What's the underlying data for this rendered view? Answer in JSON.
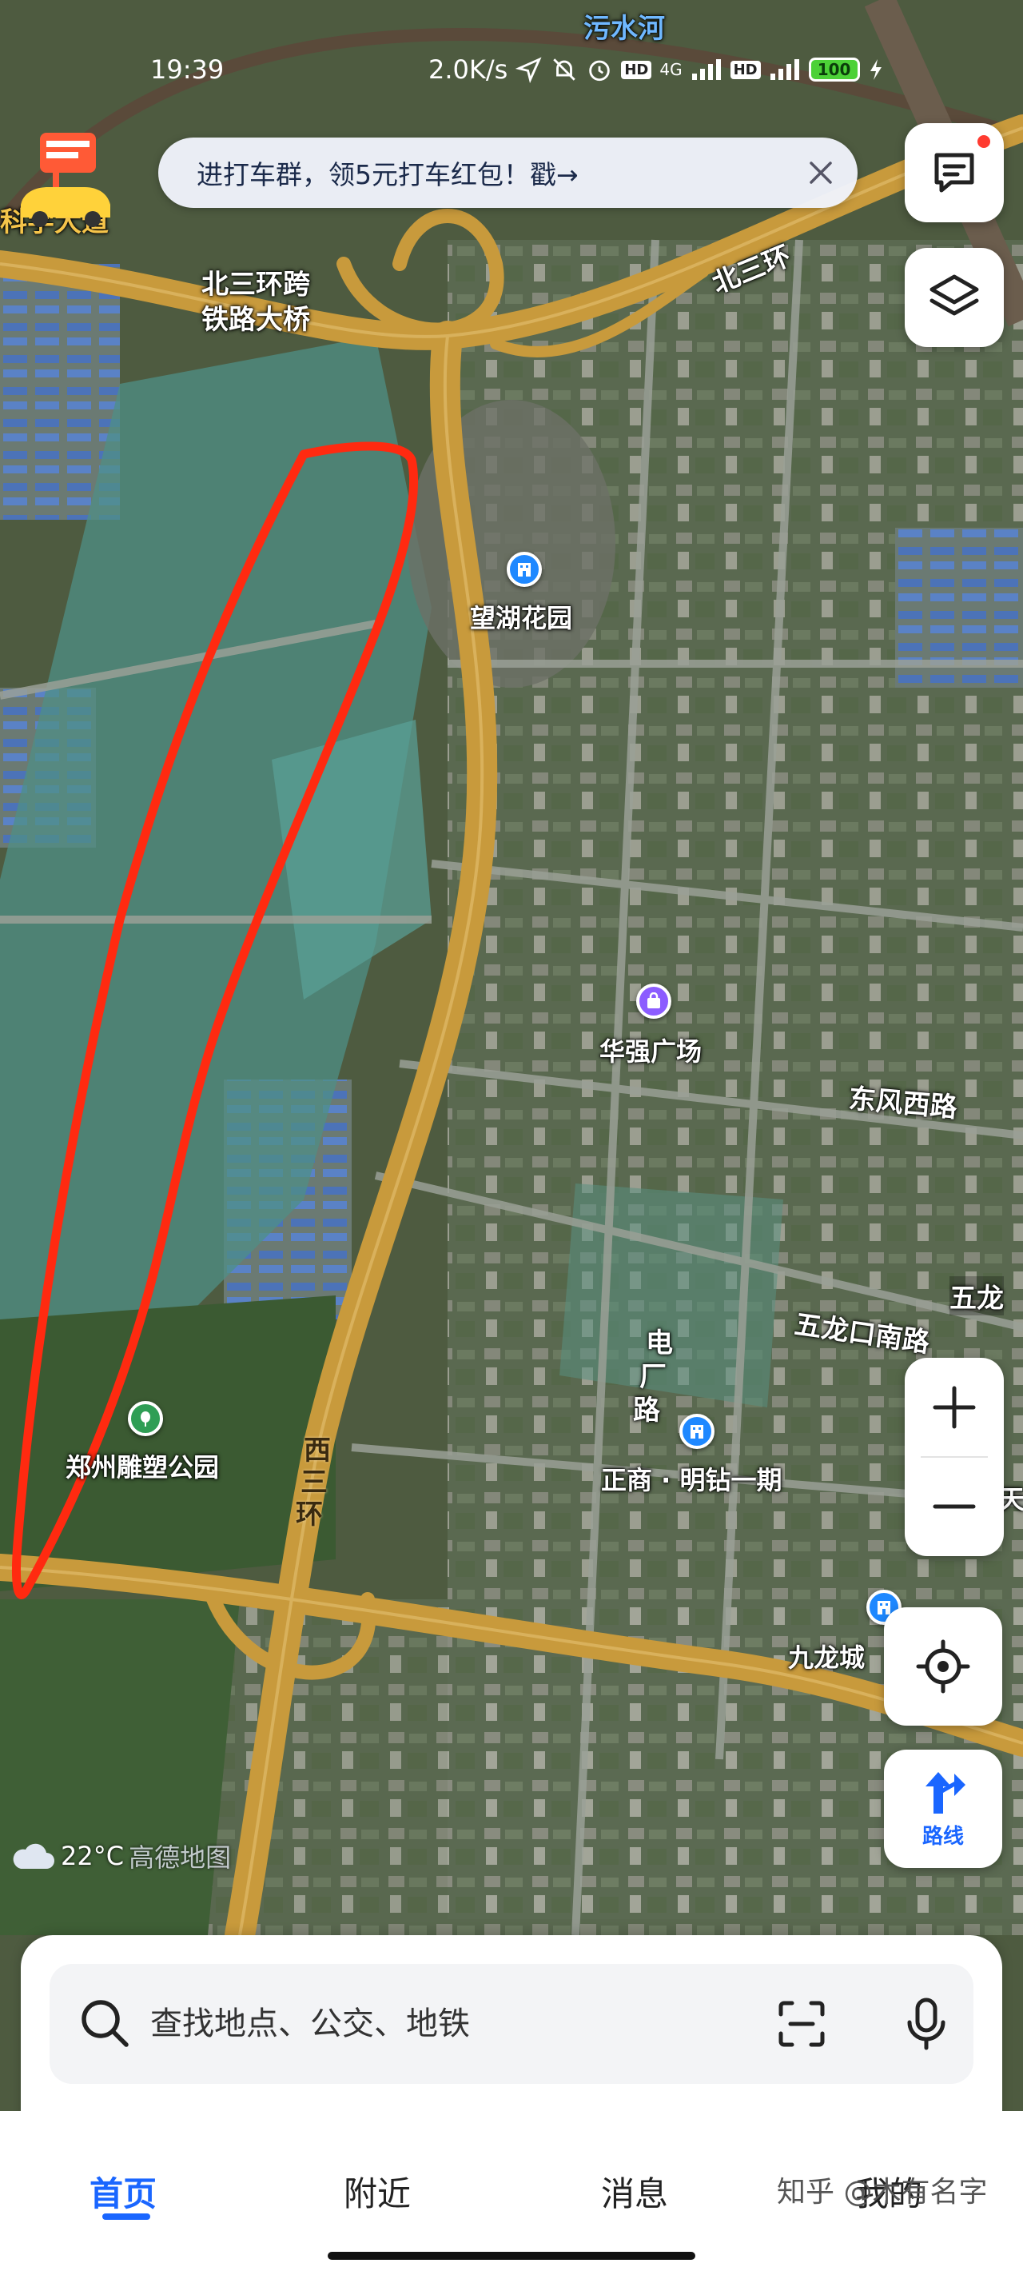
{
  "status_bar": {
    "time": "19:39",
    "network_speed": "2.0K/s",
    "network_type": "4G",
    "battery": "100"
  },
  "banner": {
    "text": "进打车群，领5元打车红包！戳→"
  },
  "map": {
    "labels": {
      "wushui_river": "污水河",
      "north_third_ring": "北三环",
      "north_bridge": [
        "北三环跨",
        "铁路大桥"
      ],
      "wanghu_garden": "望湖花园",
      "huaqiang_plaza": "华强广场",
      "dongfeng_west_road": "东风西路",
      "wulong": "五龙",
      "wulongkou_south_road": "五龙口南路",
      "dianchang_road": [
        "电",
        "厂",
        "路"
      ],
      "zhengshang": "正商 · 明钻一期",
      "west_third_ring": [
        "西",
        "三",
        "环"
      ],
      "sculpture_park": "郑州雕塑公园",
      "jiulong_city": "九龙城",
      "kexue_avenue": "科学大道",
      "tian": "天"
    },
    "colors": {
      "highlight": "#ff2a10",
      "road_primary": "#c89a3c",
      "poi_blue": "#1e88ff",
      "poi_purple": "#8c5cff",
      "poi_green": "#2f9e55"
    }
  },
  "controls": {
    "route_label": "路线",
    "zoom_in": "+",
    "zoom_out": "−"
  },
  "weather": {
    "temperature": "22°C",
    "brand": "高德地图"
  },
  "search": {
    "placeholder": "查找地点、公交、地铁"
  },
  "tabs": [
    {
      "label": "首页",
      "active": true
    },
    {
      "label": "附近",
      "active": false
    },
    {
      "label": "消息",
      "active": false
    },
    {
      "label": "我的",
      "active": false
    }
  ],
  "watermark": "知乎 @木有名字"
}
